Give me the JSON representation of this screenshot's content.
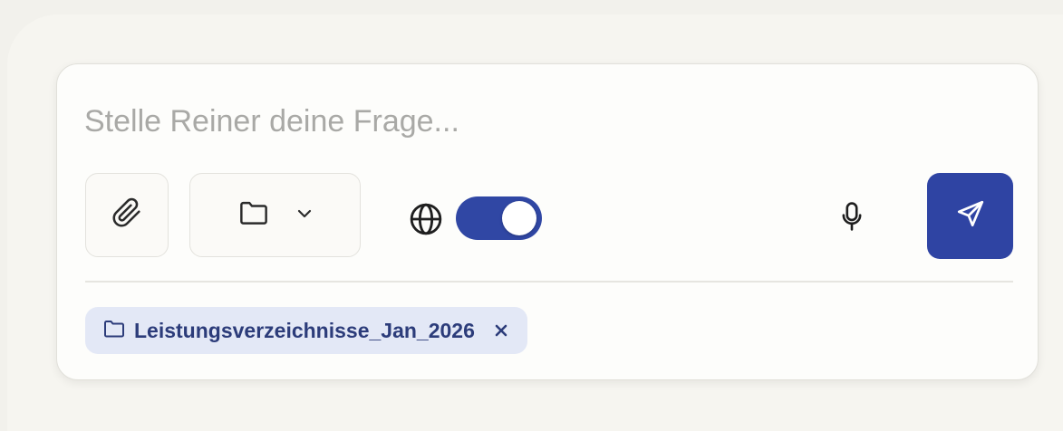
{
  "composer": {
    "placeholder": "Stelle Reiner deine Frage...",
    "value": ""
  },
  "toolbar": {
    "attach_icon": "paperclip-icon",
    "folder_icon": "folder-icon",
    "folder_dropdown_icon": "chevron-down-icon",
    "web_search_icon": "globe-icon",
    "web_search_enabled": true,
    "mic_icon": "microphone-icon",
    "send_icon": "send-icon"
  },
  "selected_folder": {
    "label": "Leistungsverzeichnisse_Jan_2026",
    "icon": "folder-icon",
    "remove_icon": "close-icon"
  },
  "colors": {
    "accent": "#2f44a3",
    "chip_background": "#e3e8f6",
    "chip_text": "#2c3c7a",
    "page_background": "#f2f1ec"
  }
}
